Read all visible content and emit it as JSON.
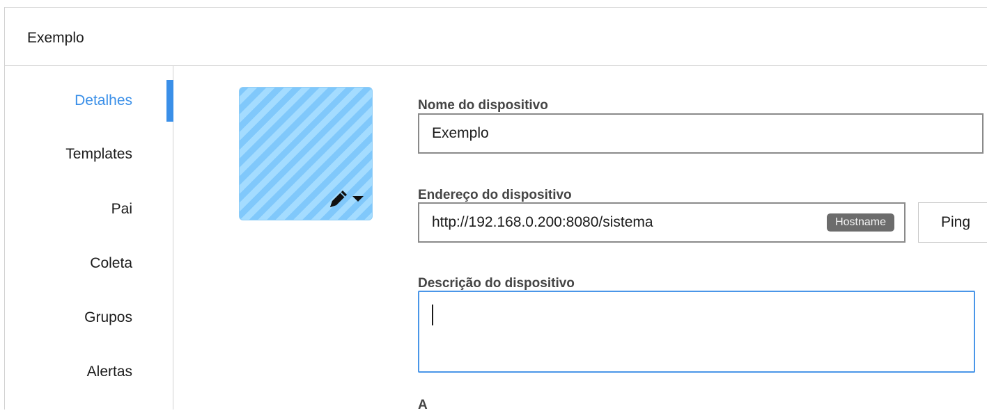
{
  "header": {
    "title": "Exemplo"
  },
  "sidebar": {
    "items": [
      {
        "label": "Detalhes",
        "active": true
      },
      {
        "label": "Templates"
      },
      {
        "label": "Pai"
      },
      {
        "label": "Coleta"
      },
      {
        "label": "Grupos"
      },
      {
        "label": "Alertas"
      }
    ]
  },
  "avatar": {
    "icon": "pencil-icon",
    "dropdown_icon": "caret-down-icon"
  },
  "form": {
    "name_label": "Nome do dispositivo",
    "name_value": "Exemplo",
    "address_label": "Endereço do dispositivo",
    "address_value": "http://192.168.0.200:8080/sistema",
    "address_badge": "Hostname",
    "ping_label": "Ping",
    "description_label": "Descrição do dispositivo",
    "description_value": ""
  },
  "colors": {
    "accent": "#3a8fe8",
    "avatar_fill": "#8fd3ff",
    "badge_bg": "#6c6c6c"
  }
}
